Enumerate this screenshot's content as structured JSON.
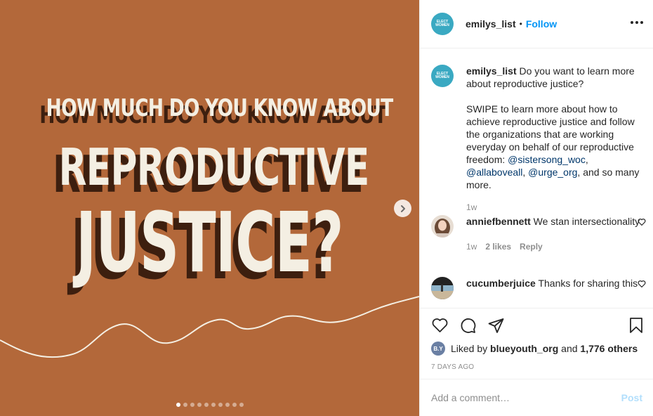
{
  "media": {
    "background_color": "#b3683a",
    "headline_line1": "HOW MUCH DO YOU KNOW ABOUT",
    "headline_line2": "REPRODUCTIVE",
    "headline_line3": "JUSTICE?",
    "carousel_dots": 10,
    "active_dot": 0
  },
  "header": {
    "avatar_text": "ELECT WOMEN",
    "username": "emilys_list",
    "separator": "•",
    "follow_label": "Follow"
  },
  "caption": {
    "username": "emilys_list",
    "text_part1": "Do you want to learn more about reproductive justice?",
    "text_part2": "SWIPE to learn more about how to achieve reproductive justice and follow the organizations that are working everyday on behalf of our reproductive freedom: ",
    "mention1": "@sistersong_woc",
    "comma1": ", ",
    "mention2": "@allaboveall",
    "comma2": ",",
    "mention3": "@urge_org",
    "text_part3": ", and so many more.",
    "time": "1w"
  },
  "comments": [
    {
      "username": "anniefbennett",
      "text": "We stan intersectionality",
      "time": "1w",
      "likes": "2 likes",
      "reply": "Reply"
    },
    {
      "username": "cucumberjuice",
      "text": "Thanks for sharing this"
    }
  ],
  "actions": {
    "liked_prefix": "Liked by",
    "liked_user": "blueyouth_org",
    "liked_and": "and",
    "liked_others": "1,776 others",
    "liked_avatar_text": "B.Y",
    "date": "7 DAYS AGO"
  },
  "add_comment": {
    "placeholder": "Add a comment…",
    "post_label": "Post"
  },
  "icons": {
    "like": "heart-icon",
    "comment": "comment-icon",
    "share": "paper-plane-icon",
    "save": "bookmark-icon",
    "next": "chevron-right-icon",
    "more": "more-dots-icon"
  }
}
